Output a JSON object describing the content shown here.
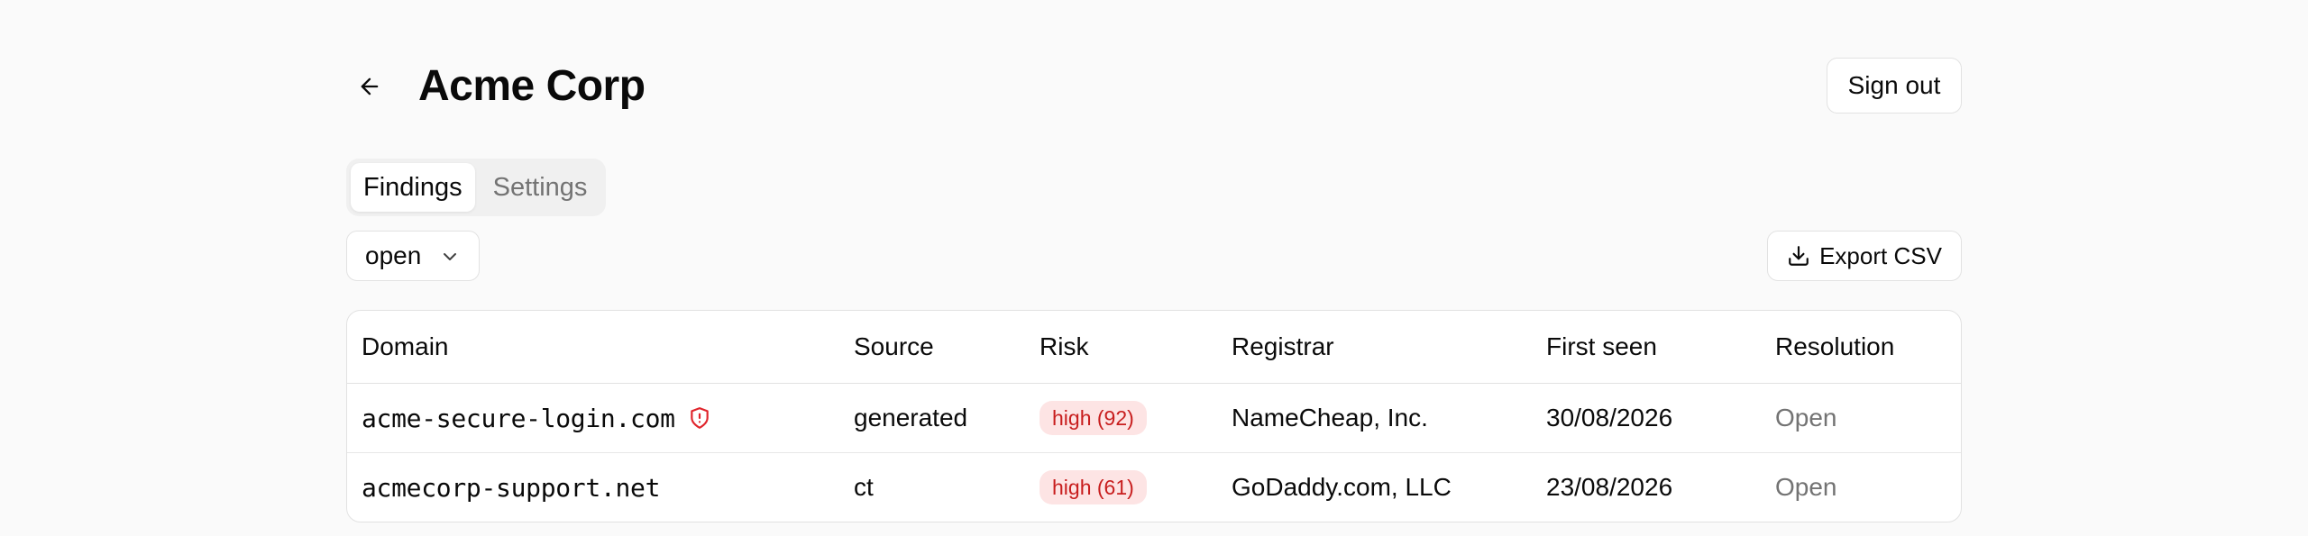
{
  "header": {
    "title": "Acme Corp",
    "sign_out_label": "Sign out"
  },
  "tabs": [
    {
      "label": "Findings",
      "active": true
    },
    {
      "label": "Settings",
      "active": false
    }
  ],
  "filter": {
    "selected": "open"
  },
  "toolbar": {
    "export_label": "Export CSV"
  },
  "table": {
    "columns": [
      "Domain",
      "Source",
      "Risk",
      "Registrar",
      "First seen",
      "Resolution"
    ],
    "rows": [
      {
        "domain": "acme-secure-login.com",
        "flagged": true,
        "source": "generated",
        "risk": "high (92)",
        "registrar": "NameCheap, Inc.",
        "first_seen": "30/08/2026",
        "resolution": "Open"
      },
      {
        "domain": "acmecorp-support.net",
        "flagged": false,
        "source": "ct",
        "risk": "high (61)",
        "registrar": "GoDaddy.com, LLC",
        "first_seen": "23/08/2026",
        "resolution": "Open"
      }
    ]
  },
  "colors": {
    "background": "#fafafa",
    "risk_badge_bg": "#fde4e4",
    "risk_badge_text": "#c81e1e",
    "flag_icon": "#e0242b"
  },
  "icons": {
    "back": "arrow-left-icon",
    "select": "chevron-down-icon",
    "export": "download-icon",
    "flag": "shield-alert-icon"
  }
}
